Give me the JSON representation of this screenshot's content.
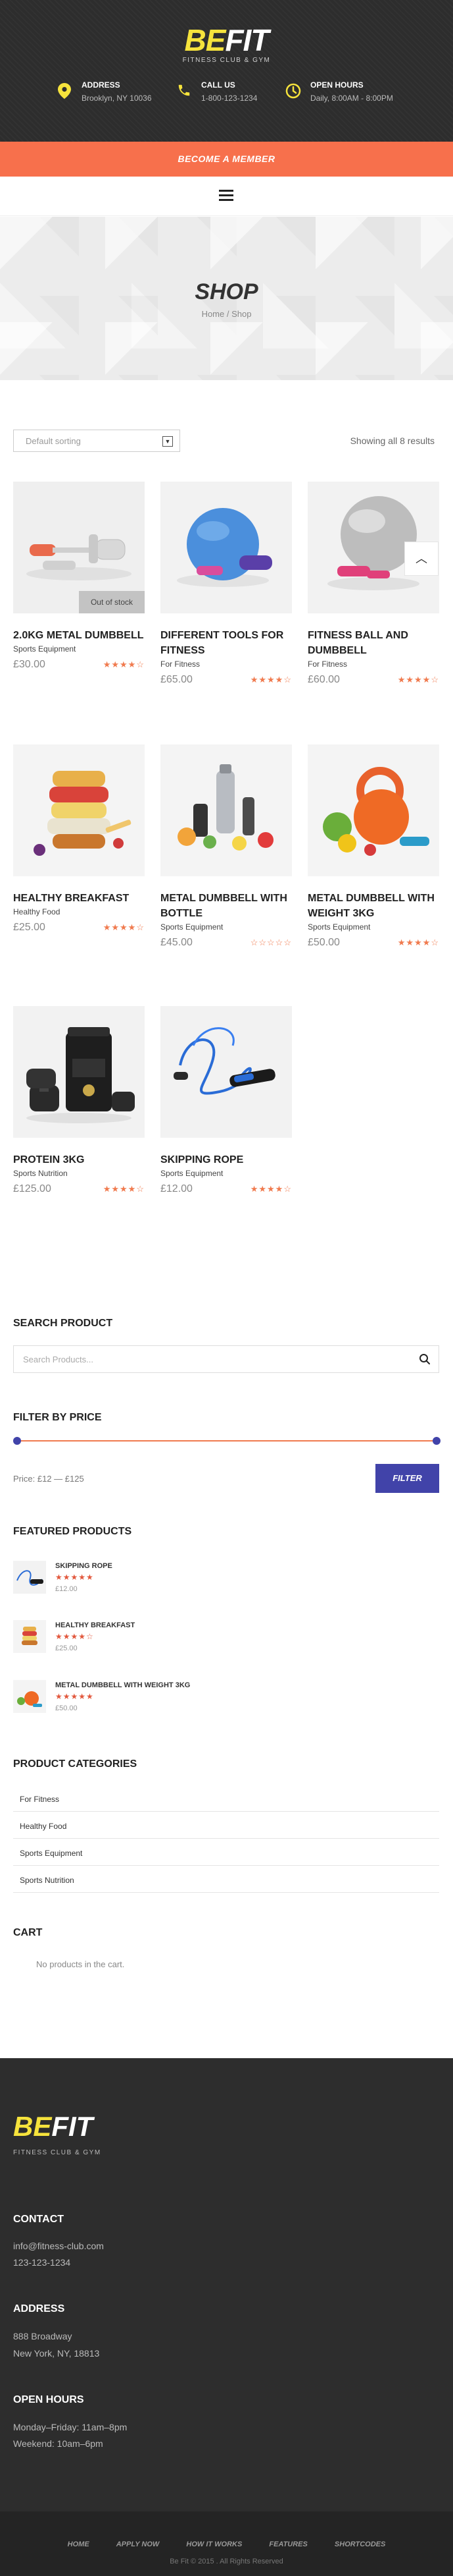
{
  "header": {
    "logo_be": "BE",
    "logo_fit": "FIT",
    "tagline": "FITNESS CLUB & GYM",
    "address_label": "ADDRESS",
    "address_value": "Brooklyn, NY 10036",
    "call_label": "CALL US",
    "call_value": "1-800-123-1234",
    "hours_label": "OPEN HOURS",
    "hours_value": "Daily, 8:00AM - 8:00PM",
    "member_cta": "BECOME A MEMBER"
  },
  "hero": {
    "title": "SHOP",
    "breadcrumb": "Home / Shop"
  },
  "toolbar": {
    "sort_value": "Default sorting",
    "result_count": "Showing all 8 results"
  },
  "products": [
    {
      "title": "2.0KG METAL DUMBBELL",
      "category": "Sports Equipment",
      "price": "£30.00",
      "rating": 4,
      "out_of_stock": "Out of stock"
    },
    {
      "title": "DIFFERENT TOOLS FOR FITNESS",
      "category": "For Fitness",
      "price": "£65.00",
      "rating": 4
    },
    {
      "title": "FITNESS BALL AND DUMBBELL",
      "category": "For Fitness",
      "price": "£60.00",
      "rating": 4
    },
    {
      "title": "HEALTHY BREAKFAST",
      "category": "Healthy Food",
      "price": "£25.00",
      "rating": 4
    },
    {
      "title": "METAL DUMBBELL WITH BOTTLE",
      "category": "Sports Equipment",
      "price": "£45.00",
      "rating": 0
    },
    {
      "title": "METAL DUMBBELL WITH WEIGHT 3KG",
      "category": "Sports Equipment",
      "price": "£50.00",
      "rating": 4
    },
    {
      "title": "PROTEIN 3KG",
      "category": "Sports Nutrition",
      "price": "£125.00",
      "rating": 4
    },
    {
      "title": "SKIPPING ROPE",
      "category": "Sports Equipment",
      "price": "£12.00",
      "rating": 4
    }
  ],
  "sidebar": {
    "search_title": "SEARCH PRODUCT",
    "search_placeholder": "Search Products...",
    "filter_title": "FILTER BY PRICE",
    "price_label": "Price: £12 — £125",
    "filter_button": "FILTER",
    "featured_title": "FEATURED PRODUCTS",
    "featured": [
      {
        "name": "SKIPPING ROPE",
        "price": "£12.00",
        "rating": 5
      },
      {
        "name": "HEALTHY BREAKFAST",
        "price": "£25.00",
        "rating": 4
      },
      {
        "name": "METAL DUMBBELL WITH WEIGHT 3KG",
        "price": "£50.00",
        "rating": 5
      }
    ],
    "categories_title": "PRODUCT CATEGORIES",
    "categories": [
      "For Fitness",
      "Healthy Food",
      "Sports Equipment",
      "Sports Nutrition"
    ],
    "cart_title": "CART",
    "cart_empty": "No products in the cart."
  },
  "footer": {
    "logo_be": "BE",
    "logo_fit": "FIT",
    "tagline": "FITNESS CLUB & GYM",
    "contact_title": "CONTACT",
    "contact_email": "info@fitness-club.com",
    "contact_phone": "123-123-1234",
    "address_title": "ADDRESS",
    "address_line1": "888 Broadway",
    "address_line2": "New York, NY, 18813",
    "hours_title": "OPEN HOURS",
    "hours_line1": "Monday–Friday: 11am–8pm",
    "hours_line2": "Weekend: 10am–6pm",
    "links": [
      "HOME",
      "APPLY NOW",
      "HOW IT WORKS",
      "FEATURES",
      "SHORTCODES"
    ],
    "copyright": "Be Fit © 2015 . All Rights Reserved"
  },
  "colors": {
    "accent": "#f7704c",
    "brand_yellow": "#f6e33c",
    "button_blue": "#4143a9"
  }
}
